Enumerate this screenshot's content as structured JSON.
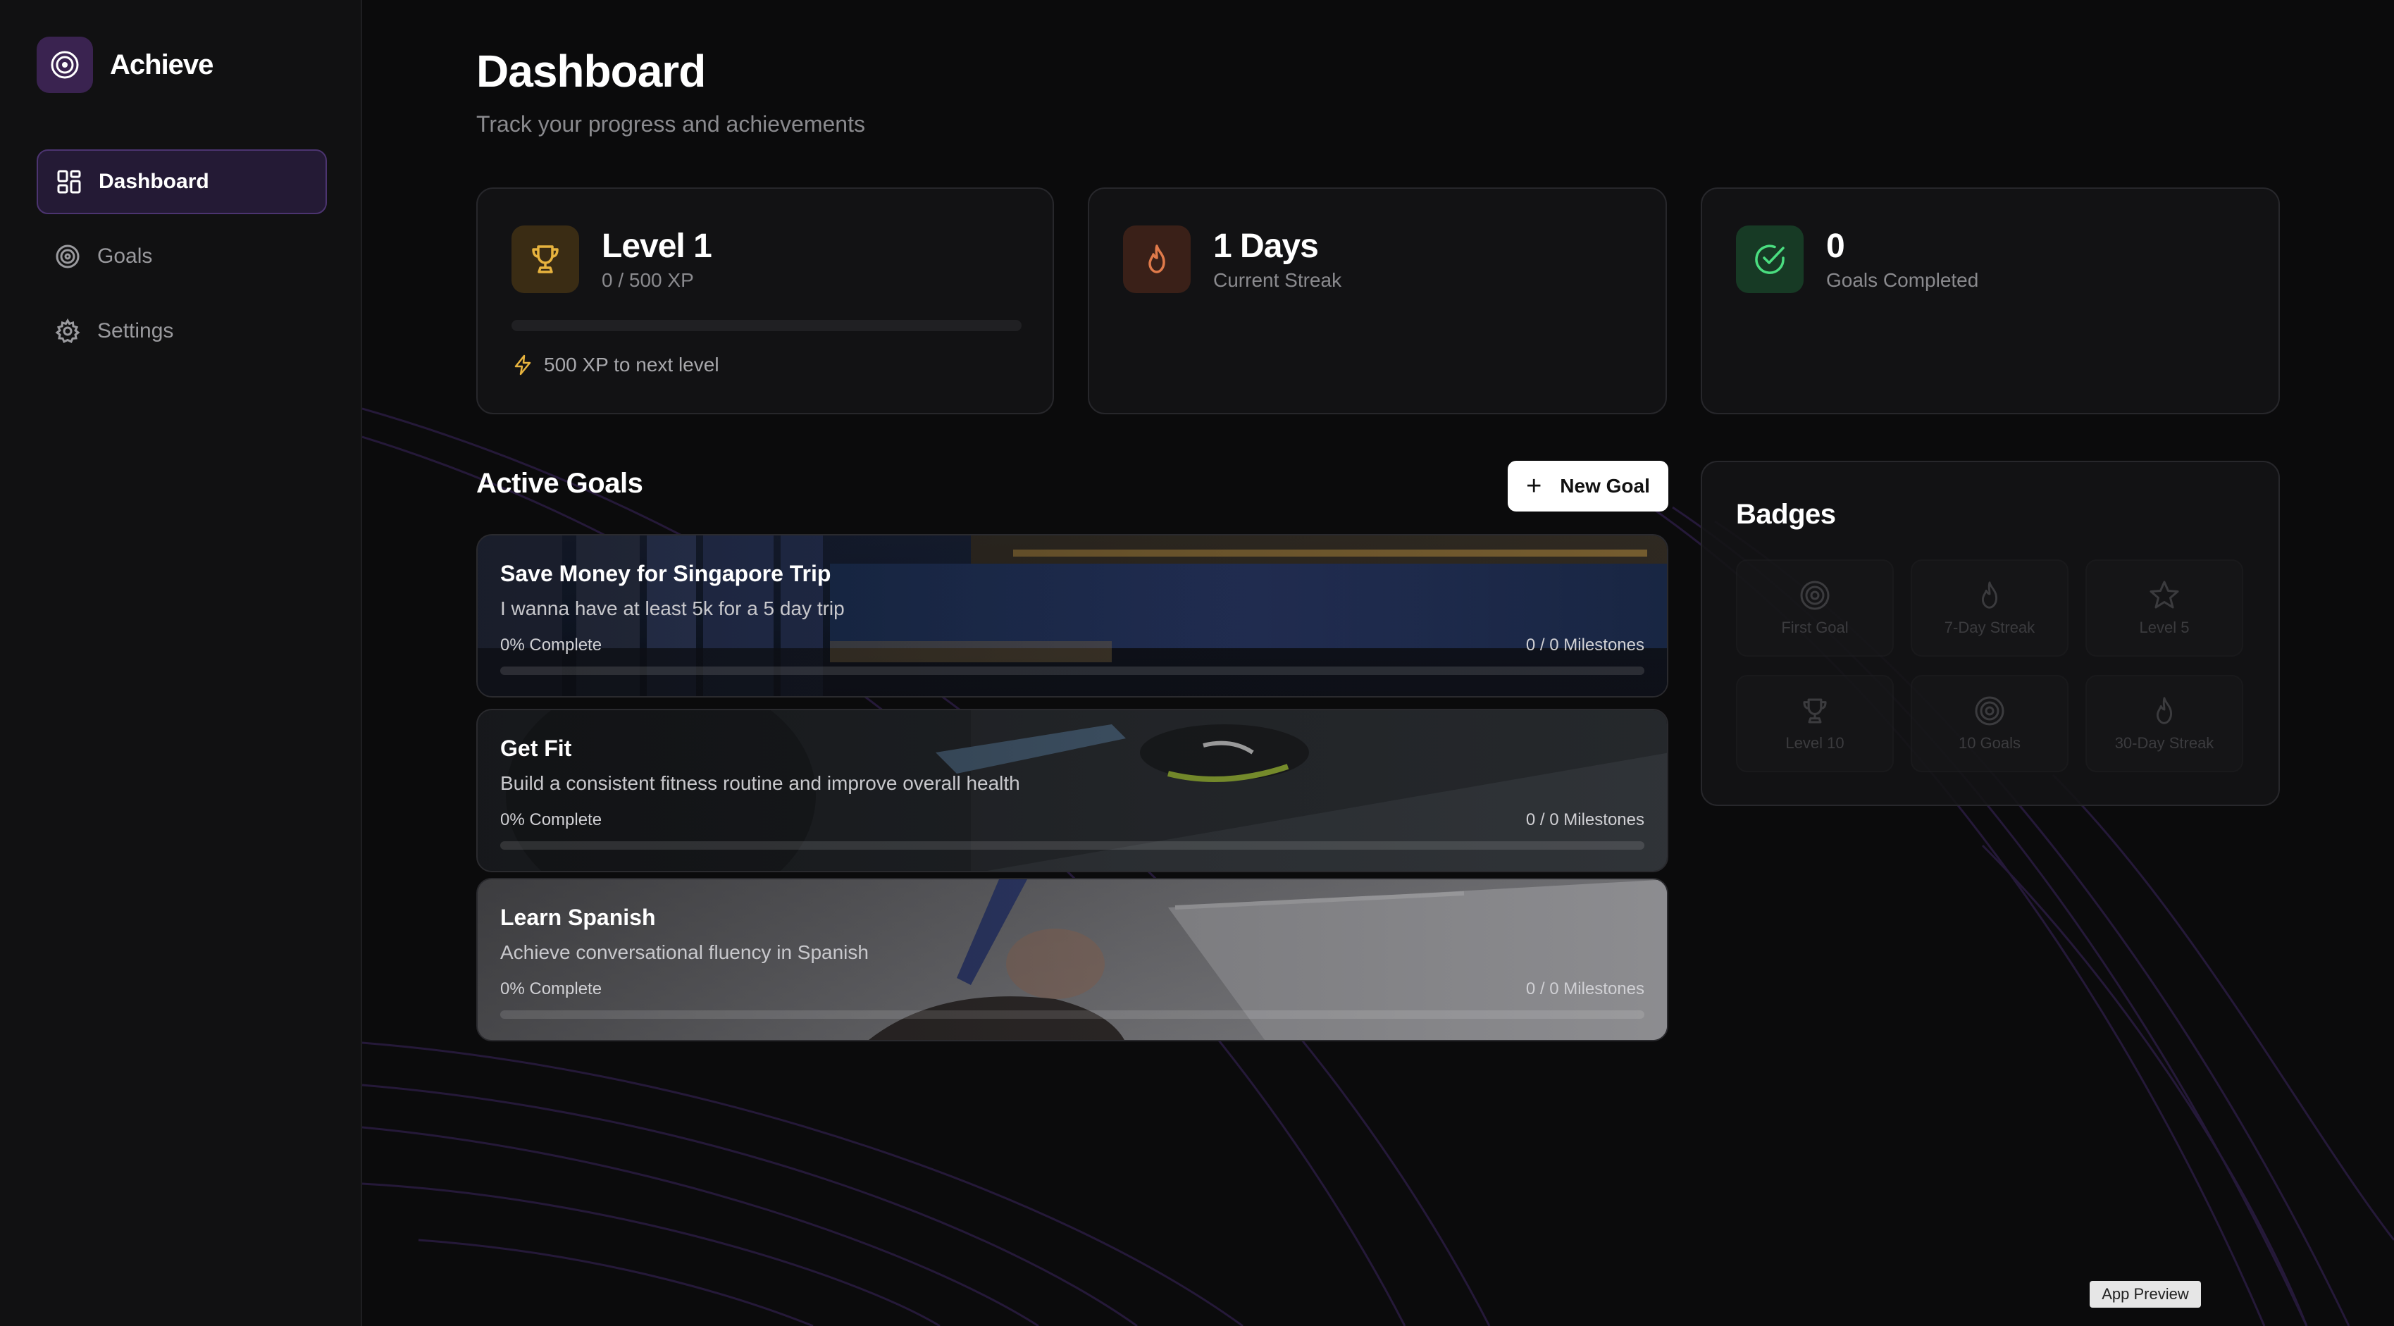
{
  "app": {
    "name": "Achieve"
  },
  "sidebar": {
    "items": [
      {
        "label": "Dashboard",
        "icon": "dashboard-grid-icon",
        "active": true
      },
      {
        "label": "Goals",
        "icon": "target-icon",
        "active": false
      },
      {
        "label": "Settings",
        "icon": "gear-icon",
        "active": false
      }
    ]
  },
  "header": {
    "title": "Dashboard",
    "subtitle": "Track your progress and achievements"
  },
  "stats": {
    "level": {
      "title": "Level 1",
      "sub": "0 / 500 XP",
      "progress": 0,
      "next": "500 XP to next level",
      "icon": "trophy-icon"
    },
    "streak": {
      "title": "1 Days",
      "sub": "Current Streak",
      "icon": "flame-icon"
    },
    "completed": {
      "title": "0",
      "sub": "Goals Completed",
      "icon": "check-circle-icon"
    }
  },
  "active_goals": {
    "title": "Active Goals",
    "new_goal_label": "New Goal",
    "goals": [
      {
        "title": "Save Money for Singapore Trip",
        "description": "I wanna have at least 5k for a 5 day trip",
        "progress_text": "0% Complete",
        "milestones": "0 / 0 Milestones",
        "progress": 0
      },
      {
        "title": "Get Fit",
        "description": "Build a consistent fitness routine and improve overall health",
        "progress_text": "0% Complete",
        "milestones": "0 / 0 Milestones",
        "progress": 0
      },
      {
        "title": "Learn Spanish",
        "description": "Achieve conversational fluency in Spanish",
        "progress_text": "0% Complete",
        "milestones": "0 / 0 Milestones",
        "progress": 0
      }
    ]
  },
  "badges": {
    "title": "Badges",
    "items": [
      {
        "label": "First Goal",
        "icon": "target-icon"
      },
      {
        "label": "7-Day Streak",
        "icon": "flame-icon"
      },
      {
        "label": "Level 5",
        "icon": "star-icon"
      },
      {
        "label": "Level 10",
        "icon": "trophy-icon"
      },
      {
        "label": "10 Goals",
        "icon": "target-icon"
      },
      {
        "label": "30-Day Streak",
        "icon": "flame-icon"
      }
    ]
  },
  "footer": {
    "preview_label": "App Preview"
  },
  "colors": {
    "accent": "#b18cf0",
    "brand_bg": "#3a2350",
    "trophy": "#e7b33e",
    "flame": "#e07a4a",
    "success": "#4ade80"
  }
}
